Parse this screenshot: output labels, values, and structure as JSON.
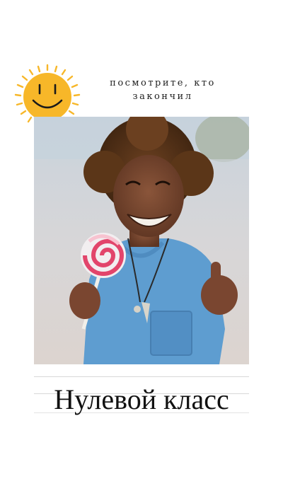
{
  "card": {
    "subtitle": "посмотрите, кто\nзакончил",
    "title": "Нулевой класс",
    "sun_icon": "smiling-sun-icon",
    "photo_subject": "child-with-lollipop-photo"
  },
  "colors": {
    "background": "#ffffff",
    "sun": "#f7b729",
    "text": "#111111"
  }
}
